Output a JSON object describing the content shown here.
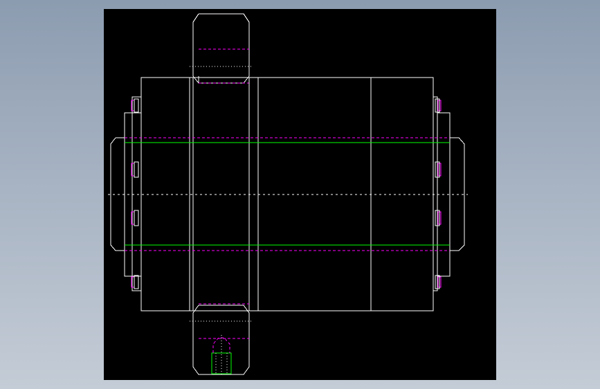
{
  "drawing": {
    "background_color": "#000000",
    "app_background_top": "#8c9cb0",
    "app_background_bottom": "#c4ccd6",
    "line_colors": {
      "outline": "#ffffff",
      "hidden": "#ff00ff",
      "green": "#00ff00",
      "centerline": "#ffffff"
    }
  }
}
